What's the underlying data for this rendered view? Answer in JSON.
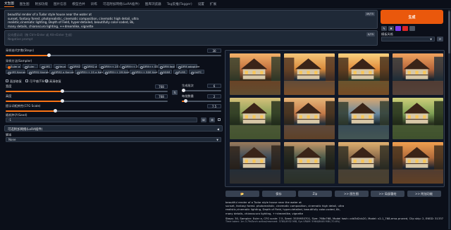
{
  "tabs": [
    "文生图",
    "图生图",
    "附加功能",
    "图片信息",
    "模型合并",
    "训练",
    "可选附加网络(LoRA插件)",
    "图库浏览器",
    "Tag反推(Tagger)",
    "设置",
    "扩展"
  ],
  "prompt": {
    "text": "beautiful render of a Tudor style house near the water at\nsunset, fantasy forest. photorealistic, cinematic composition, cinematic high detail, ultra\nrealistic,cinematic lighting, Depth of Field, hyper-detailed, beautifully color-coded, 8k,\nmany details, chiaroscuro lighting, ++dreamlike, vignette",
    "counter": "49/75"
  },
  "negative": {
    "placeholder": "反向提示词（按 Ctrl+Enter 或 Alt+Enter 生成）\nNegative prompt",
    "counter": "0/75"
  },
  "generate_label": "生成",
  "styles_label": "模板风格",
  "sampling_steps": {
    "label": "采样迭代步数(Steps)",
    "value": "30",
    "fraction": 0.2
  },
  "sampler": {
    "label": "采样方法(Sampler)",
    "rows": [
      [
        "Euler a",
        "Euler",
        "LMS",
        "Heun",
        "DPM2",
        "DPM2 a",
        "DPM++ 2S a",
        "DPM++ 2M",
        "DPM++ SDE",
        "DPM fast",
        "DPM adaptive"
      ],
      [
        "LMS Karras",
        "DPM2 Karras",
        "DPM2 a Karras",
        "DPM++ 2S a Karras",
        "DPM++ 2M Karras",
        "DPM++ SDE Karras",
        "DDIM",
        "PLMS",
        "UniPC"
      ]
    ],
    "selected": "Euler a"
  },
  "checks": [
    "面部修复",
    "可平铺(Tiling)",
    "高清修复"
  ],
  "width": {
    "label": "宽度",
    "value": "768",
    "fraction": 0.35
  },
  "height": {
    "label": "高度",
    "value": "768",
    "fraction": 0.35
  },
  "batch_count": {
    "label": "生成批次",
    "value": "6",
    "fraction": 0.05
  },
  "batch_size": {
    "label": "每批数量",
    "value": "2",
    "fraction": 0.1
  },
  "cfg": {
    "label": "提示词相关性(CFG Scale)",
    "value": "7.5",
    "fraction": 0.23
  },
  "seed": {
    "label": "随机种子(Seed)",
    "value": "-1"
  },
  "lora": {
    "label": "可选附加网络(LoRA插件)"
  },
  "script": {
    "label": "脚本",
    "value": "None"
  },
  "actions": [
    "📂",
    "保存",
    "Zip",
    ">> 图生图",
    ">> 局部重绘",
    ">> 附加功能"
  ],
  "info_lines": [
    "beautiful render of a Tudor style house near the water at",
    "sunset, fantasy forest. photorealistic, cinematic composition, cinematic high detail, ultra",
    "realistic,cinematic lighting, Depth of Field, hyper-detailed, beautifully color-coded, 8k,",
    "many details, chiaroscuro lighting, ++dreamlike, vignette",
    "Steps: 30, Sampler: Euler a, CFG scale: 7.5, Seed: 3539930701, Size: 768x768, Model hash: cdd3d2cb20, Model: v2-1_768-ema-pruned, Clip skip: 2, ENSD: 31337",
    "Time taken: 1m 3.79sTorch active/reserved: 3780/4932 MiB, Sys VRAM: 5964/8448 MiB (70.6%)"
  ],
  "colors": {
    "accent": "#f97316",
    "generate": "#ea580c",
    "bg": "#0b0f19"
  }
}
